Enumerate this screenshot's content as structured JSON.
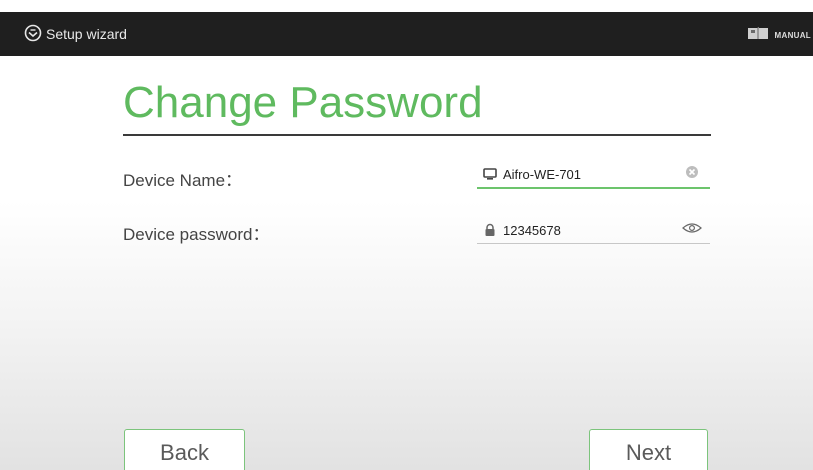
{
  "header": {
    "title": "Setup wizard",
    "manual_label": "MANUAL"
  },
  "page": {
    "title": "Change Password"
  },
  "form": {
    "device_name": {
      "label": "Device Name：",
      "value": "Aifro-WE-701"
    },
    "device_password": {
      "label": "Device password：",
      "value": "12345678"
    }
  },
  "buttons": {
    "back": "Back",
    "next": "Next"
  },
  "icons": {
    "logo": "wizard-logo-icon",
    "manual": "book-icon",
    "device": "monitor-icon",
    "clear": "clear-icon",
    "lock": "lock-icon",
    "reveal": "eye-icon"
  },
  "colors": {
    "accent": "#5fba5f",
    "titlebar": "#1f1f1f"
  }
}
